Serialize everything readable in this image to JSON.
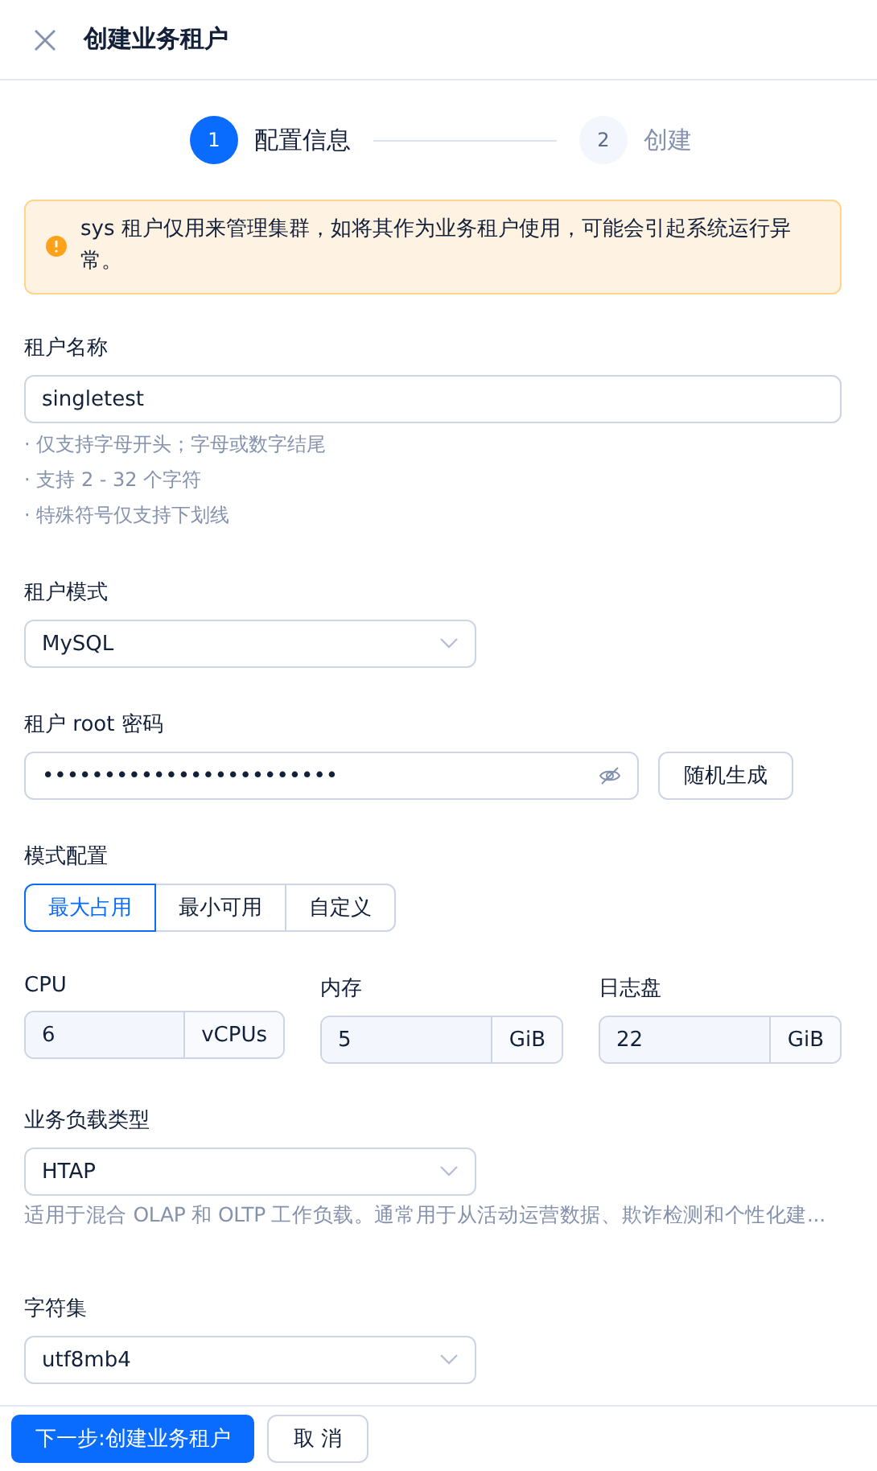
{
  "header": {
    "title": "创建业务租户"
  },
  "steps": [
    {
      "number": "1",
      "label": "配置信息",
      "selected": true
    },
    {
      "number": "2",
      "label": "创建",
      "selected": false
    }
  ],
  "alert": {
    "text": "sys 租户仅用来管理集群，如将其作为业务租户使用，可能会引起系统运行异常。"
  },
  "tenant_name": {
    "label": "租户名称",
    "value": "singletest",
    "hints": [
      "· 仅支持字母开头；字母或数字结尾",
      "· 支持 2 - 32 个字符",
      "· 特殊符号仅支持下划线"
    ]
  },
  "tenant_mode": {
    "label": "租户模式",
    "value": "MySQL"
  },
  "root_password": {
    "label": "租户 root 密码",
    "value": "••••••••••••••••••••••••",
    "button": "随机生成"
  },
  "mode_config": {
    "label": "模式配置",
    "options": [
      {
        "label": "最大占用",
        "selected": true
      },
      {
        "label": "最小可用",
        "selected": false
      },
      {
        "label": "自定义",
        "selected": false
      }
    ]
  },
  "resources": [
    {
      "label": "CPU",
      "value": "6",
      "unit": "vCPUs"
    },
    {
      "label": "内存",
      "value": "5",
      "unit": "GiB"
    },
    {
      "label": "日志盘",
      "value": "22",
      "unit": "GiB"
    }
  ],
  "workload_type": {
    "label": "业务负载类型",
    "value": "HTAP",
    "description": "适用于混合 OLAP 和 OLTP 工作负载。通常用于从活动运营数据、欺诈检测和个性化建..."
  },
  "charset": {
    "label": "字符集",
    "value": "utf8mb4"
  },
  "footer": {
    "primary": "下一步:创建业务租户",
    "secondary": "取 消"
  }
}
